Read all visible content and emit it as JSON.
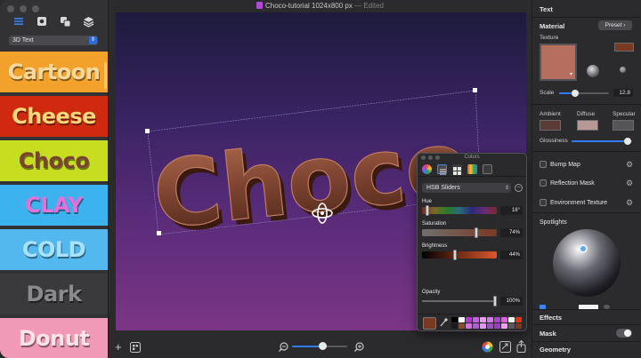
{
  "window": {
    "title": "Choco-tutorial 1024x800 px",
    "status": "Edited"
  },
  "sidebar": {
    "mode_icons": [
      "list-icon",
      "gear-icon",
      "layers-copy-icon",
      "stack-icon"
    ],
    "category_select": "3D Text",
    "styles": [
      {
        "label": "Cartoon",
        "bg": "#f2a12b",
        "fg": "#f7d9a0"
      },
      {
        "label": "Cheese",
        "bg": "#cf2a10",
        "fg": "#f9d77a"
      },
      {
        "label": "Choco",
        "bg": "#c6dd20",
        "fg": "#7a4530"
      },
      {
        "label": "CLAY",
        "bg": "#3cb2ee",
        "fg": "#e86fd9"
      },
      {
        "label": "COLD",
        "bg": "#52b8ee",
        "fg": "#a9e2ff"
      },
      {
        "label": "Dark",
        "bg": "#3a3a3c",
        "fg": "#8a8a8c"
      },
      {
        "label": "Donut",
        "bg": "#f19ab7",
        "fg": "#fbe3ea"
      }
    ]
  },
  "canvas": {
    "text": "Choco",
    "text_color": "#7a4330",
    "text_highlight": "#a4624a"
  },
  "bottombar": {
    "add_label": "+",
    "zoom_level": 0.55
  },
  "colors_panel": {
    "title": "Colors",
    "mode": "HSB Sliders",
    "hue": {
      "label": "Hue",
      "value": "18°",
      "level": 0.05
    },
    "saturation": {
      "label": "Saturation",
      "value": "74%",
      "level": 0.74
    },
    "brightness": {
      "label": "Brightness",
      "value": "44%",
      "level": 0.44
    },
    "opacity": {
      "label": "Opacity",
      "value": "100%",
      "level": 1.0
    },
    "current_color": "#7a3a22",
    "swatches": [
      "#000000",
      "#ffffff",
      "#b33ad1",
      "#c85ee3",
      "#e79df0",
      "#d27ae6",
      "#a947c7",
      "#e35de1",
      "#ffffff",
      "#e0361e",
      "#1a1a1a",
      "#8a4a2c",
      "#d770e8",
      "#b25bd1",
      "#e493f0",
      "#a050c4",
      "#9d3cc4",
      "#f0a0f0",
      "#5a5a5a",
      "#7a3a22"
    ]
  },
  "inspector": {
    "section_text": "Text",
    "material_label": "Material",
    "preset_label": "Preset",
    "texture_label": "Texture",
    "scale_label": "Scale",
    "scale_value": "12.8",
    "scale_level": 0.33,
    "ambient_label": "Ambient",
    "diffuse_label": "Diffuse",
    "specular_label": "Specular",
    "ambient_color": "#5a3b35",
    "diffuse_color": "#b89895",
    "specular_color": "#555558",
    "glossiness_label": "Glossiness",
    "glossiness_level": 0.92,
    "bump_map_label": "Bump Map",
    "reflection_mask_label": "Reflection Mask",
    "environment_texture_label": "Environment Texture",
    "spotlights_label": "Spotlights",
    "effects_label": "Effects",
    "mask_label": "Mask",
    "geometry_label": "Geometry",
    "texture_color": "#b66f5e",
    "texture_swatch_color": "#7a3a22"
  }
}
